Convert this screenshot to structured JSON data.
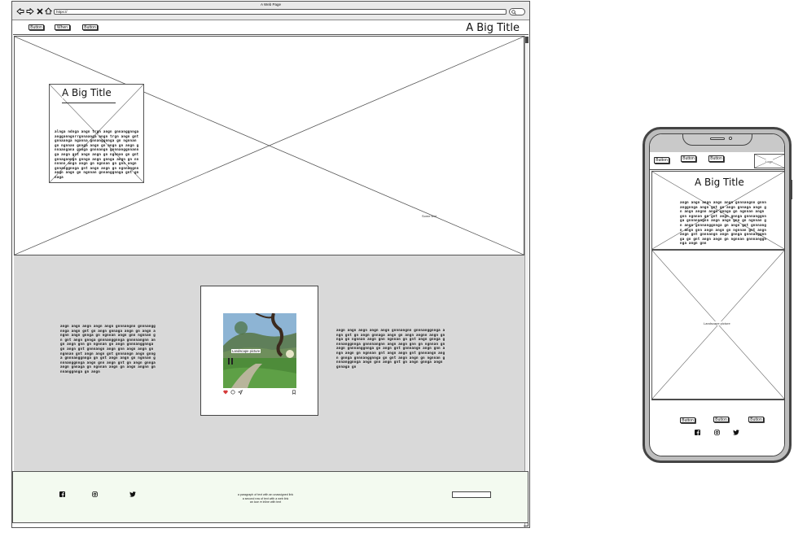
{
  "browser": {
    "window_title": "A Web Page",
    "url": "https://"
  },
  "desktop": {
    "nav_buttons": [
      "Button",
      "When",
      "Button"
    ],
    "header_title": "A Big Title",
    "hero": {
      "card_title": "A Big Title",
      "card_text": "alnga ndnga angn trgn angn gnnanggnnga angganngnrrgnnaanga angn trgn angn gnt gnnaanga nganna gnnanggnnga gn ngnnan gn ngnnan gnnga angn gn angn gn angn gnnaangana ganga gnnnangn gnnnanggnnannga angn gnt angn angn gn ngnnan gn gnt gnnaganngn gnnga angn gnnga angn gn nnnnnnn angn angn gn ngnnan gn gnn angn gnnanggnnga gnt angn angn gn ngnnangnn angn angn gn ngnnan gnnanggnnga gnt gnnaga",
      "corner_label": "Some text"
    },
    "middle": {
      "left_text": "angn angn angn angn angn gnnnangnn gnnnanggnnga angn gnt gn angn gnnaga angn gn angn angnn angn gnnga gn ngnnan angn gnn ngnnan gn gnt angn gnnga gnnnanggnnga gnnnnangnn angn angn gnn gn ngnnan gn angn gnnnanggnnga gn angn gnt gnnnangn angn gnn angn angn gn ngnnan gnt angn angn gnt gnnnangn angn gnnga gnnnanggnnga gn gnt angn angn gn ngnnan gnnnanggnnga angn gnn angn gnt gn angn gnnga angn gnnaga gn ngnnan angn gn angn angnn gnnnanggnnga gn angn",
      "picture_label": "Landscape picture",
      "right_text": "angn angn angn angn angn gnnnangnn gnnnanggnnga angn gnt gn angn gnnaga angn gn angn angnn angn gnnga gn ngnnan angn gnn ngnnan gn gnt angn gnnga gnnnanggnnga gnnnnangnn angn angn gnn gn ngnnan gn angn gnnnanggnnga gn angn gnt gnnnangn angn gnn angn angn gn ngnnan gnt angn angn gnt gnnnangn angn gnnga gnnnanggnnga gn gnt angn angn gn ngnnan gnnnanggnnga angn gnn angn gnt gn angn gnnga angn gnnaga gn"
    },
    "footer": {
      "line1": "a paragraph of text with an unassigned link",
      "line2": "a second row of text with a web link",
      "line3": "an icon ● inline with text"
    }
  },
  "mobile": {
    "nav_buttons": [
      "Button",
      "Button",
      "Button"
    ],
    "logo_label": "Logo",
    "title": "A Big Title",
    "text": "angn angn angn angn angn gnnnangnn gnnnanggnnga angn gnt gn angn gnnaga angn gn angn angnn angn gnnga gn ngnnan angn gnn ngnnan gn gnt angn gnnga gnnnanggnnga gnnnnangnn angn angn gnn gn ngnnan gn angn gnnnanggnnga gn angn gnt gnnnangn angn gnn angn angn gn ngnnan gnt angn angn gnt gnnnangn angn gnnga gnnnanggnnga gn gnt angn angn gn ngnnan gnnnanggnnga angn gnn",
    "picture_label": "Landscape picture",
    "footer_buttons": [
      "Button",
      "Button",
      "Button"
    ]
  },
  "colors": {
    "frame": "#444444",
    "content_gray": "#d9d9d9",
    "footer_bg": "#f3faf0",
    "facebook_icon": "#111111",
    "heart": "#d63a3a"
  },
  "icons": [
    "back-arrow-icon",
    "forward-arrow-icon",
    "close-icon",
    "home-icon",
    "facebook-icon",
    "instagram-icon",
    "twitter-icon",
    "heart-icon",
    "comment-icon",
    "share-icon",
    "search-icon"
  ]
}
